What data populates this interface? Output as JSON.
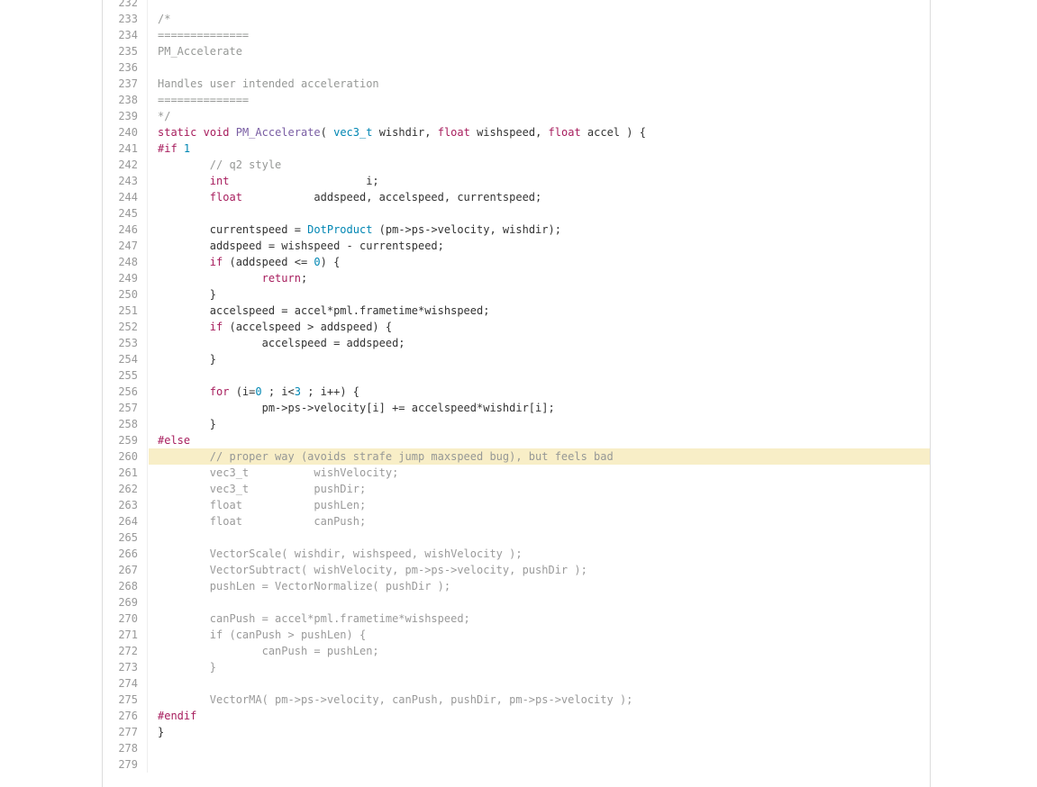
{
  "theme": {
    "comment_color": "#969896",
    "keyword_color": "#a71d5d",
    "function_color": "#795da3",
    "type_color": "#0086b3",
    "highlight_color": "#f8eec7"
  },
  "code": {
    "highlighted_line": 260,
    "lines": [
      {
        "n": "232",
        "t": [
          {
            "s": ""
          }
        ]
      },
      {
        "n": "233",
        "t": [
          {
            "s": "/*",
            "c": "cm"
          }
        ]
      },
      {
        "n": "234",
        "t": [
          {
            "s": "==============",
            "c": "cm"
          }
        ]
      },
      {
        "n": "235",
        "t": [
          {
            "s": "PM_Accelerate",
            "c": "cm"
          }
        ]
      },
      {
        "n": "236",
        "t": [
          {
            "s": ""
          }
        ]
      },
      {
        "n": "237",
        "t": [
          {
            "s": "Handles user intended acceleration",
            "c": "cm"
          }
        ]
      },
      {
        "n": "238",
        "t": [
          {
            "s": "==============",
            "c": "cm"
          }
        ]
      },
      {
        "n": "239",
        "t": [
          {
            "s": "*/",
            "c": "cm"
          }
        ]
      },
      {
        "n": "240",
        "t": [
          {
            "s": "static",
            "c": "kw"
          },
          {
            "s": " "
          },
          {
            "s": "void",
            "c": "kw"
          },
          {
            "s": " "
          },
          {
            "s": "PM_Accelerate",
            "c": "fn"
          },
          {
            "s": "( "
          },
          {
            "s": "vec3_t",
            "c": "ty"
          },
          {
            "s": " wishdir, "
          },
          {
            "s": "float",
            "c": "kw"
          },
          {
            "s": " wishspeed, "
          },
          {
            "s": "float",
            "c": "kw"
          },
          {
            "s": " accel ) {"
          }
        ]
      },
      {
        "n": "241",
        "t": [
          {
            "s": "#if ",
            "c": "pp"
          },
          {
            "s": "1",
            "c": "nu"
          }
        ]
      },
      {
        "n": "242",
        "t": [
          {
            "s": "        "
          },
          {
            "s": "// q2 style",
            "c": "cm"
          }
        ]
      },
      {
        "n": "243",
        "t": [
          {
            "s": "        "
          },
          {
            "s": "int",
            "c": "kw"
          },
          {
            "s": "                     i;"
          }
        ]
      },
      {
        "n": "244",
        "t": [
          {
            "s": "        "
          },
          {
            "s": "float",
            "c": "kw"
          },
          {
            "s": "           addspeed, accelspeed, currentspeed;"
          }
        ]
      },
      {
        "n": "245",
        "t": [
          {
            "s": ""
          }
        ]
      },
      {
        "n": "246",
        "t": [
          {
            "s": "        currentspeed = "
          },
          {
            "s": "DotProduct",
            "c": "ty"
          },
          {
            "s": " (pm->ps->velocity, wishdir);"
          }
        ]
      },
      {
        "n": "247",
        "t": [
          {
            "s": "        addspeed = wishspeed - currentspeed;"
          }
        ]
      },
      {
        "n": "248",
        "t": [
          {
            "s": "        "
          },
          {
            "s": "if",
            "c": "kw"
          },
          {
            "s": " (addspeed <= "
          },
          {
            "s": "0",
            "c": "nu"
          },
          {
            "s": ") {"
          }
        ]
      },
      {
        "n": "249",
        "t": [
          {
            "s": "                "
          },
          {
            "s": "return",
            "c": "kw"
          },
          {
            "s": ";"
          }
        ]
      },
      {
        "n": "250",
        "t": [
          {
            "s": "        }"
          }
        ]
      },
      {
        "n": "251",
        "t": [
          {
            "s": "        accelspeed = accel*pml.frametime*wishspeed;"
          }
        ]
      },
      {
        "n": "252",
        "t": [
          {
            "s": "        "
          },
          {
            "s": "if",
            "c": "kw"
          },
          {
            "s": " (accelspeed > addspeed) {"
          }
        ]
      },
      {
        "n": "253",
        "t": [
          {
            "s": "                accelspeed = addspeed;"
          }
        ]
      },
      {
        "n": "254",
        "t": [
          {
            "s": "        }"
          }
        ]
      },
      {
        "n": "255",
        "t": [
          {
            "s": ""
          }
        ]
      },
      {
        "n": "256",
        "t": [
          {
            "s": "        "
          },
          {
            "s": "for",
            "c": "kw"
          },
          {
            "s": " (i="
          },
          {
            "s": "0",
            "c": "nu"
          },
          {
            "s": " ; i<"
          },
          {
            "s": "3",
            "c": "nu"
          },
          {
            "s": " ; i++) {"
          }
        ]
      },
      {
        "n": "257",
        "t": [
          {
            "s": "                pm->ps->velocity[i] += accelspeed*wishdir[i];"
          }
        ]
      },
      {
        "n": "258",
        "t": [
          {
            "s": "        }"
          }
        ]
      },
      {
        "n": "259",
        "t": [
          {
            "s": "#else",
            "c": "pp"
          }
        ]
      },
      {
        "n": "260",
        "t": [
          {
            "s": "        "
          },
          {
            "s": "// proper way (avoids strafe jump maxspeed bug), but feels bad",
            "c": "cm"
          }
        ]
      },
      {
        "n": "261",
        "t": [
          {
            "s": "        vec3_t          wishVelocity;",
            "c": "dis"
          }
        ]
      },
      {
        "n": "262",
        "t": [
          {
            "s": "        vec3_t          pushDir;",
            "c": "dis"
          }
        ]
      },
      {
        "n": "263",
        "t": [
          {
            "s": "        float           pushLen;",
            "c": "dis"
          }
        ]
      },
      {
        "n": "264",
        "t": [
          {
            "s": "        float           canPush;",
            "c": "dis"
          }
        ]
      },
      {
        "n": "265",
        "t": [
          {
            "s": ""
          }
        ]
      },
      {
        "n": "266",
        "t": [
          {
            "s": "        VectorScale( wishdir, wishspeed, wishVelocity );",
            "c": "dis"
          }
        ]
      },
      {
        "n": "267",
        "t": [
          {
            "s": "        VectorSubtract( wishVelocity, pm->ps->velocity, pushDir );",
            "c": "dis"
          }
        ]
      },
      {
        "n": "268",
        "t": [
          {
            "s": "        pushLen = VectorNormalize( pushDir );",
            "c": "dis"
          }
        ]
      },
      {
        "n": "269",
        "t": [
          {
            "s": ""
          }
        ]
      },
      {
        "n": "270",
        "t": [
          {
            "s": "        canPush = accel*pml.frametime*wishspeed;",
            "c": "dis"
          }
        ]
      },
      {
        "n": "271",
        "t": [
          {
            "s": "        if (canPush > pushLen) {",
            "c": "dis"
          }
        ]
      },
      {
        "n": "272",
        "t": [
          {
            "s": "                canPush = pushLen;",
            "c": "dis"
          }
        ]
      },
      {
        "n": "273",
        "t": [
          {
            "s": "        }",
            "c": "dis"
          }
        ]
      },
      {
        "n": "274",
        "t": [
          {
            "s": ""
          }
        ]
      },
      {
        "n": "275",
        "t": [
          {
            "s": "        VectorMA( pm->ps->velocity, canPush, pushDir, pm->ps->velocity );",
            "c": "dis"
          }
        ]
      },
      {
        "n": "276",
        "t": [
          {
            "s": "#endif",
            "c": "pp"
          }
        ]
      },
      {
        "n": "277",
        "t": [
          {
            "s": "}"
          }
        ]
      },
      {
        "n": "278",
        "t": [
          {
            "s": ""
          }
        ]
      },
      {
        "n": "279",
        "t": [
          {
            "s": ""
          }
        ]
      }
    ]
  }
}
